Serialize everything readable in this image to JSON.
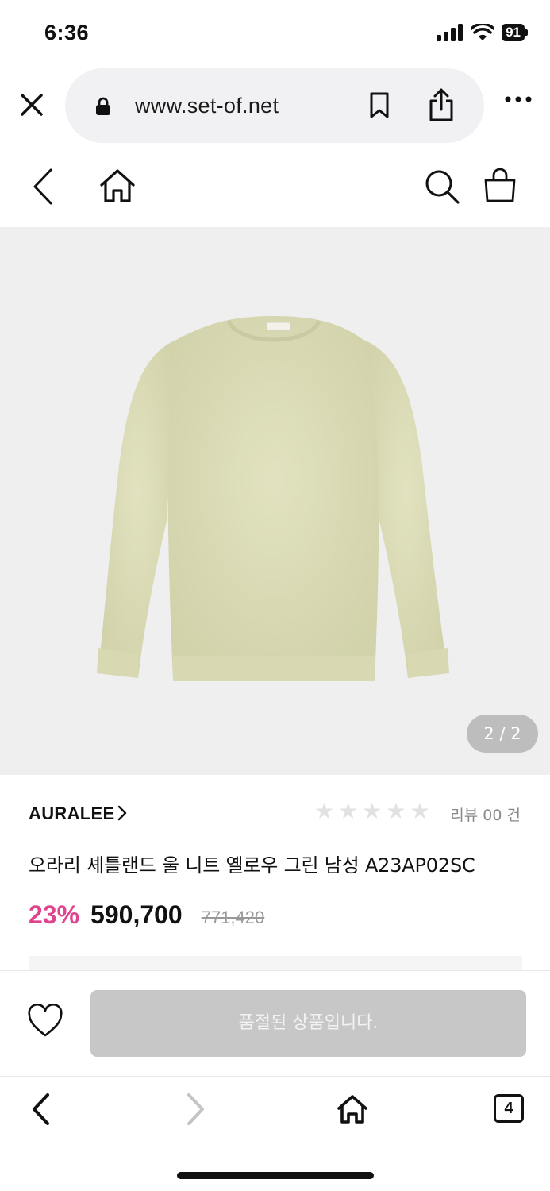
{
  "status_bar": {
    "time": "6:36",
    "battery": "91",
    "icons": [
      "cellular-signal-icon",
      "wifi-icon",
      "battery-icon"
    ]
  },
  "browser": {
    "url": "www.set-of.net",
    "icons": [
      "close-icon",
      "lock-icon",
      "bookmark-icon",
      "share-icon",
      "more-icon"
    ]
  },
  "site_header": {
    "icons": [
      "back-icon",
      "home-icon",
      "search-icon",
      "shopping-bag-icon"
    ]
  },
  "gallery": {
    "pager": "2 / 2",
    "label_on_garment": "AURALEE"
  },
  "product": {
    "brand": "AURALEE",
    "rating_stars": 0,
    "rating_max": 5,
    "review_text": "리뷰 00 건",
    "title": "오라리 셰틀랜드 울 니트 옐로우 그린 남성 A23AP02SC",
    "discount": "23%",
    "price": "590,700",
    "original_price": "771,420"
  },
  "purchase_bar": {
    "soldout_label": "품절된 상품입니다.",
    "icons": [
      "heart-icon"
    ]
  },
  "toolbar": {
    "tab_count": "4",
    "icons": [
      "back-icon",
      "forward-icon",
      "home-icon",
      "tabs-icon"
    ]
  },
  "colors": {
    "accent_discount": "#e0448e",
    "image_background": "#efefef",
    "disabled_button": "#c7c7c7",
    "sweater": "#dcdcb6"
  }
}
